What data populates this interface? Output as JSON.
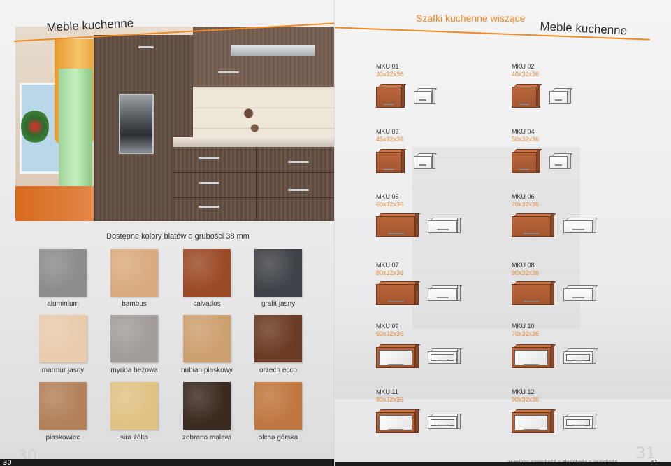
{
  "left_page": {
    "title": "Meble kuchenne",
    "colors_heading": "Dostępne kolory blatów o grubości 38 mm",
    "page_number": "30",
    "swatches": [
      {
        "label": "aluminium",
        "color": "#8e8c8a"
      },
      {
        "label": "bambus",
        "color": "#d9ab7f"
      },
      {
        "label": "calvados",
        "color": "#9b4a26"
      },
      {
        "label": "grafit jasny",
        "color": "#3f4248"
      },
      {
        "label": "marmur jasny",
        "color": "#e8ccac"
      },
      {
        "label": "myrida beżowa",
        "color": "#a29d9b"
      },
      {
        "label": "nubian piaskowy",
        "color": "#cda070"
      },
      {
        "label": "orzech ecco",
        "color": "#6a3b22"
      },
      {
        "label": "piaskowiec",
        "color": "#b2815a"
      },
      {
        "label": "sira żółta",
        "color": "#e2c285"
      },
      {
        "label": "zebrano malawi",
        "color": "#3a2a20"
      },
      {
        "label": "olcha górska",
        "color": "#c0773f"
      }
    ]
  },
  "right_page": {
    "subtitle": "Szafki kuchenne wiszące",
    "title": "Meble kuchenne",
    "page_number": "31",
    "dims_note": "wymiary: szerokość x głębokość x wysokość",
    "products": [
      {
        "code": "MKU 01",
        "dims": "30x32x36"
      },
      {
        "code": "MKU 02",
        "dims": "40x32x36"
      },
      {
        "code": "MKU 03",
        "dims": "45x32x36"
      },
      {
        "code": "MKU 04",
        "dims": "50x32x36"
      },
      {
        "code": "MKU 05",
        "dims": "60x32x36"
      },
      {
        "code": "MKU 06",
        "dims": "70x32x36"
      },
      {
        "code": "MKU 07",
        "dims": "80x32x36"
      },
      {
        "code": "MKU 08",
        "dims": "90x32x36"
      },
      {
        "code": "MKU 09",
        "dims": "60x32x36"
      },
      {
        "code": "MKU 10",
        "dims": "70x32x36"
      },
      {
        "code": "MKU 11",
        "dims": "80x32x36"
      },
      {
        "code": "MKU 12",
        "dims": "90x32x36"
      }
    ]
  },
  "colors": {
    "accent_orange": "#f08a24",
    "cabinet_wood": "#b8653a"
  }
}
